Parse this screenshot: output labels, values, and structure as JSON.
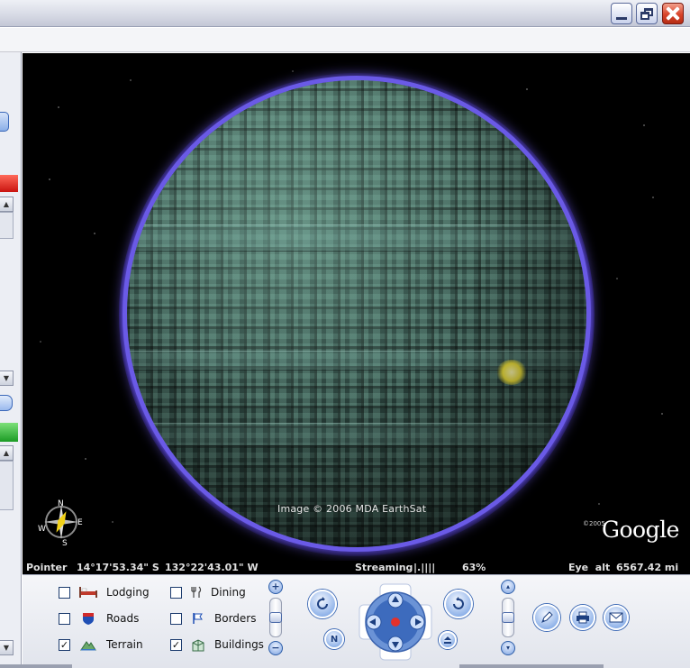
{
  "window": {
    "buttons": [
      "minimize-button",
      "maximize-button",
      "close-button"
    ]
  },
  "view": {
    "credit": "Image © 2006 MDA EarthSat",
    "logo": "Google",
    "logo_year": "©2005",
    "compass": {
      "n": "N",
      "e": "E",
      "s": "S",
      "w": "W"
    }
  },
  "status": {
    "pointer_label": "Pointer",
    "pointer_lat": "14°17'53.34\" S",
    "pointer_lon": "132°22'43.01\" W",
    "streaming_label": "Streaming",
    "streaming_bar": "|.||||",
    "streaming_pct": "63%",
    "eye_label": "Eye  alt",
    "eye_alt": "6567.42 mi"
  },
  "layers": [
    {
      "label": "Lodging",
      "checked": false,
      "icon": "bed-icon"
    },
    {
      "label": "Dining",
      "checked": false,
      "icon": "fork-knife-icon"
    },
    {
      "label": "Roads",
      "checked": false,
      "icon": "interstate-shield-icon"
    },
    {
      "label": "Borders",
      "checked": false,
      "icon": "flag-icon"
    },
    {
      "label": "Terrain",
      "checked": true,
      "icon": "mountain-icon"
    },
    {
      "label": "Buildings",
      "checked": true,
      "icon": "building-icon"
    }
  ],
  "controls": {
    "zoom_in": "+",
    "zoom_out": "−",
    "north_button": "N",
    "check_glyph": "✓"
  }
}
